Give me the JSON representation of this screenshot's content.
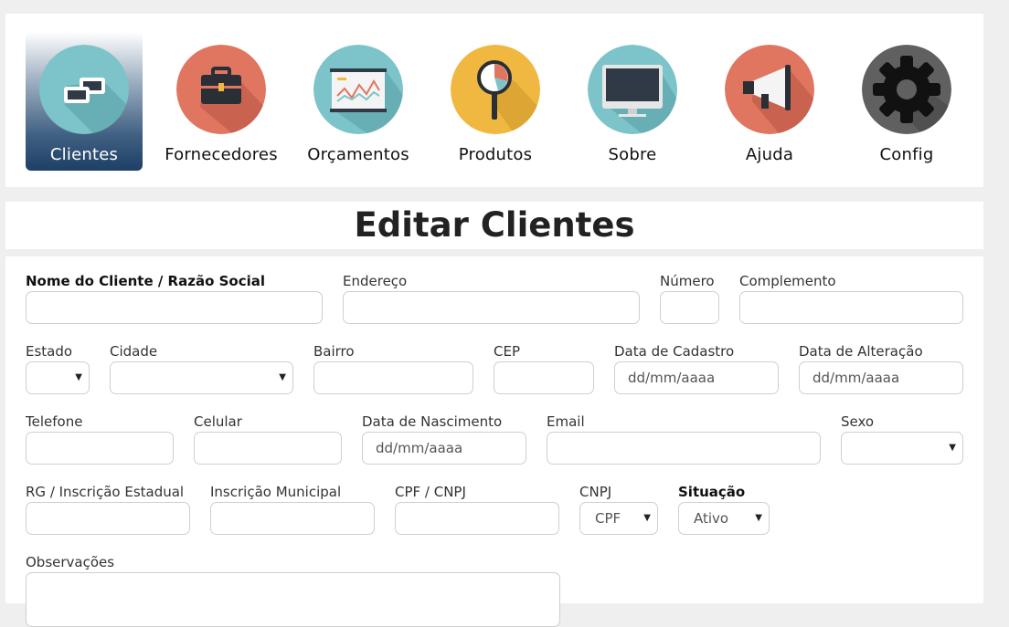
{
  "nav": {
    "items": [
      {
        "label": "Clientes",
        "icon": "clients-icon",
        "active": true
      },
      {
        "label": "Fornecedores",
        "icon": "briefcase-icon"
      },
      {
        "label": "Orçamentos",
        "icon": "presentation-chart-icon"
      },
      {
        "label": "Produtos",
        "icon": "magnifier-chart-icon"
      },
      {
        "label": "Sobre",
        "icon": "monitor-icon"
      },
      {
        "label": "Ajuda",
        "icon": "megaphone-icon"
      },
      {
        "label": "Config",
        "icon": "gear-icon"
      }
    ]
  },
  "page": {
    "title": "Editar Clientes"
  },
  "form": {
    "nome": {
      "label": "Nome do Cliente / Razão Social",
      "value": ""
    },
    "endereco": {
      "label": "Endereço",
      "value": ""
    },
    "numero": {
      "label": "Número",
      "value": ""
    },
    "complemento": {
      "label": "Complemento",
      "value": ""
    },
    "estado": {
      "label": "Estado",
      "value": ""
    },
    "cidade": {
      "label": "Cidade",
      "value": ""
    },
    "bairro": {
      "label": "Bairro",
      "value": ""
    },
    "cep": {
      "label": "CEP",
      "value": ""
    },
    "data_cadastro": {
      "label": "Data de Cadastro",
      "placeholder": "dd/mm/aaaa"
    },
    "data_alteracao": {
      "label": "Data de Alteração",
      "placeholder": "dd/mm/aaaa"
    },
    "telefone": {
      "label": "Telefone",
      "value": ""
    },
    "celular": {
      "label": "Celular",
      "value": ""
    },
    "data_nascimento": {
      "label": "Data de Nascimento",
      "placeholder": "dd/mm/aaaa"
    },
    "email": {
      "label": "Email",
      "value": ""
    },
    "sexo": {
      "label": "Sexo",
      "value": ""
    },
    "rg": {
      "label": "RG / Inscrição Estadual",
      "value": ""
    },
    "inscricao_municipal": {
      "label": "Inscrição Municipal",
      "value": ""
    },
    "cpf_cnpj": {
      "label": "CPF / CNPJ",
      "value": ""
    },
    "cnpj_tipo": {
      "label": "CNPJ",
      "value": "CPF"
    },
    "situacao": {
      "label": "Situação",
      "value": "Ativo"
    },
    "observacoes": {
      "label": "Observações",
      "value": ""
    }
  },
  "colors": {
    "accent_dark": "#1e3f66",
    "teal": "#7cc4c9",
    "coral": "#e07560",
    "yellow": "#f0b840",
    "gray": "#606060"
  }
}
